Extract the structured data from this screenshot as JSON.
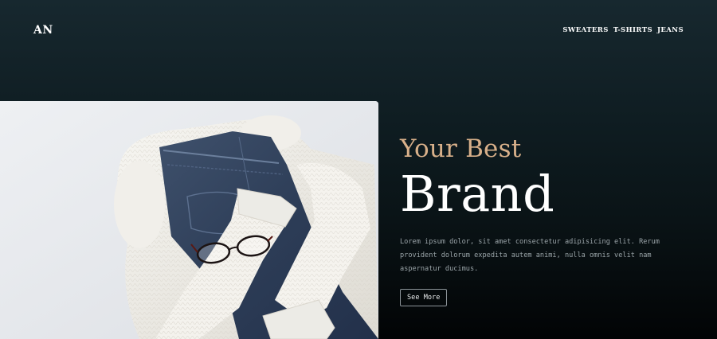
{
  "header": {
    "logo": "AN",
    "nav": [
      {
        "label": "SWEATERS"
      },
      {
        "label": "T-SHIRTS"
      },
      {
        "label": "JEANS"
      }
    ]
  },
  "hero": {
    "tagline": "Your Best",
    "title": "Brand",
    "description": "Lorem ipsum dolor, sit amet consectetur adipisicing elit. Rerum provident dolorum expedita autem animi, nulla omnis velit nam aspernatur ducimus.",
    "cta_label": "See More",
    "image_icon": "clothing-photo"
  },
  "colors": {
    "accent": "#d8b08a",
    "background_top": "#17282f",
    "background_bottom": "#020405"
  }
}
